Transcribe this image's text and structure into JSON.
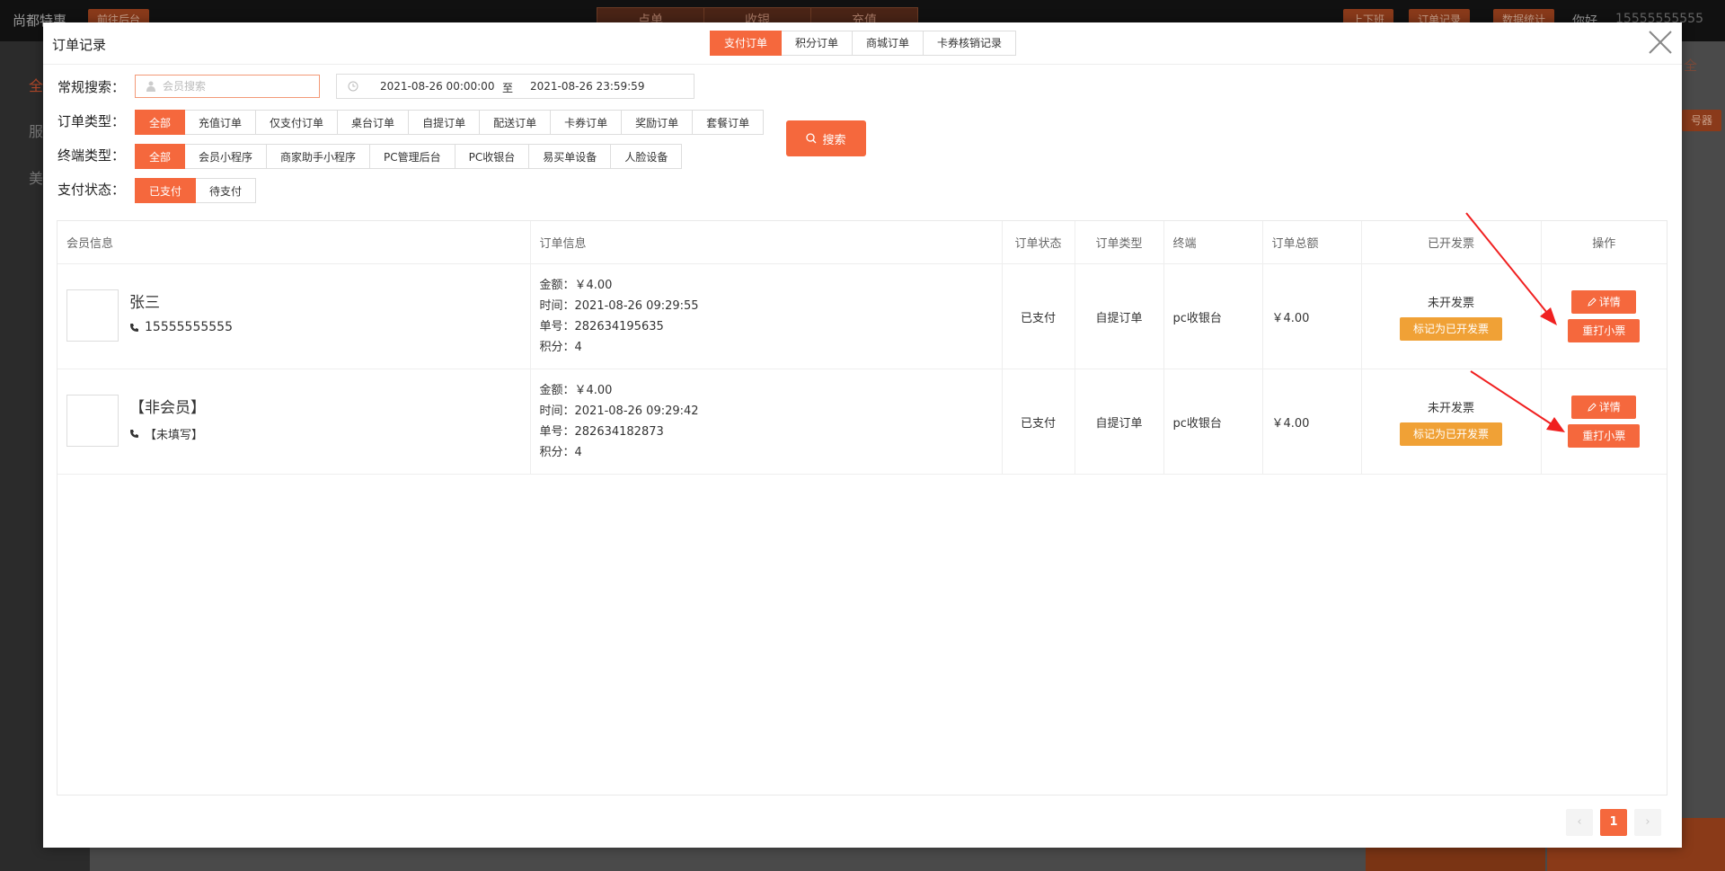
{
  "background": {
    "brand": "尚都特惠",
    "nav_button": "前往后台",
    "center_tabs": [
      "点单",
      "收银",
      "充值"
    ],
    "right_buttons": [
      "上下班",
      "订单记录",
      "数据统计"
    ],
    "greeting": "你好,",
    "phone": "15555555555",
    "side_items": [
      "全",
      "服",
      "美"
    ],
    "right_button_fragment": "号器",
    "right_top_fragment": "全"
  },
  "modal": {
    "title": "订单记录",
    "type_tabs": [
      {
        "label": "支付订单",
        "active": true
      },
      {
        "label": "积分订单",
        "active": false
      },
      {
        "label": "商城订单",
        "active": false
      },
      {
        "label": "卡券核销记录",
        "active": false
      }
    ],
    "filters": {
      "search_label": "常规搜索：",
      "search_placeholder": "会员搜索",
      "date_start": "2021-08-26 00:00:00",
      "date_sep": "至",
      "date_end": "2021-08-26 23:59:59",
      "order_type_label": "订单类型：",
      "order_types": [
        "全部",
        "充值订单",
        "仅支付订单",
        "桌台订单",
        "自提订单",
        "配送订单",
        "卡券订单",
        "奖励订单",
        "套餐订单"
      ],
      "terminal_label": "终端类型：",
      "terminals": [
        "全部",
        "会员小程序",
        "商家助手小程序",
        "PC管理后台",
        "PC收银台",
        "易买单设备",
        "人脸设备"
      ],
      "pay_status_label": "支付状态：",
      "pay_status": [
        "已支付",
        "待支付"
      ],
      "search_button": "搜索"
    },
    "table": {
      "headers": [
        "会员信息",
        "订单信息",
        "订单状态",
        "订单类型",
        "终端",
        "订单总额",
        "已开发票",
        "操作"
      ],
      "rows": [
        {
          "name": "张三",
          "phone": "15555555555",
          "amount": "金额：￥4.00",
          "time": "时间：2021-08-26 09:29:55",
          "order_no": "单号：282634195635",
          "points": "积分：4",
          "status": "已支付",
          "type": "自提订单",
          "terminal": "pc收银台",
          "total": "￥4.00",
          "invoice_status": "未开发票",
          "invoice_button": "标记为已开发票",
          "detail_button": "详情",
          "print_button": "重打小票"
        },
        {
          "name": "【非会员】",
          "phone": "【未填写】",
          "amount": "金额：￥4.00",
          "time": "时间：2021-08-26 09:29:42",
          "order_no": "单号：282634182873",
          "points": "积分：4",
          "status": "已支付",
          "type": "自提订单",
          "terminal": "pc收银台",
          "total": "￥4.00",
          "invoice_status": "未开发票",
          "invoice_button": "标记为已开发票",
          "detail_button": "详情",
          "print_button": "重打小票"
        }
      ]
    },
    "pagination": {
      "prev": "‹",
      "current": "1",
      "next": "›"
    }
  },
  "colors": {
    "accent": "#f5683d",
    "invoice_button": "#f0a136",
    "annotation_arrow": "#f02020"
  }
}
